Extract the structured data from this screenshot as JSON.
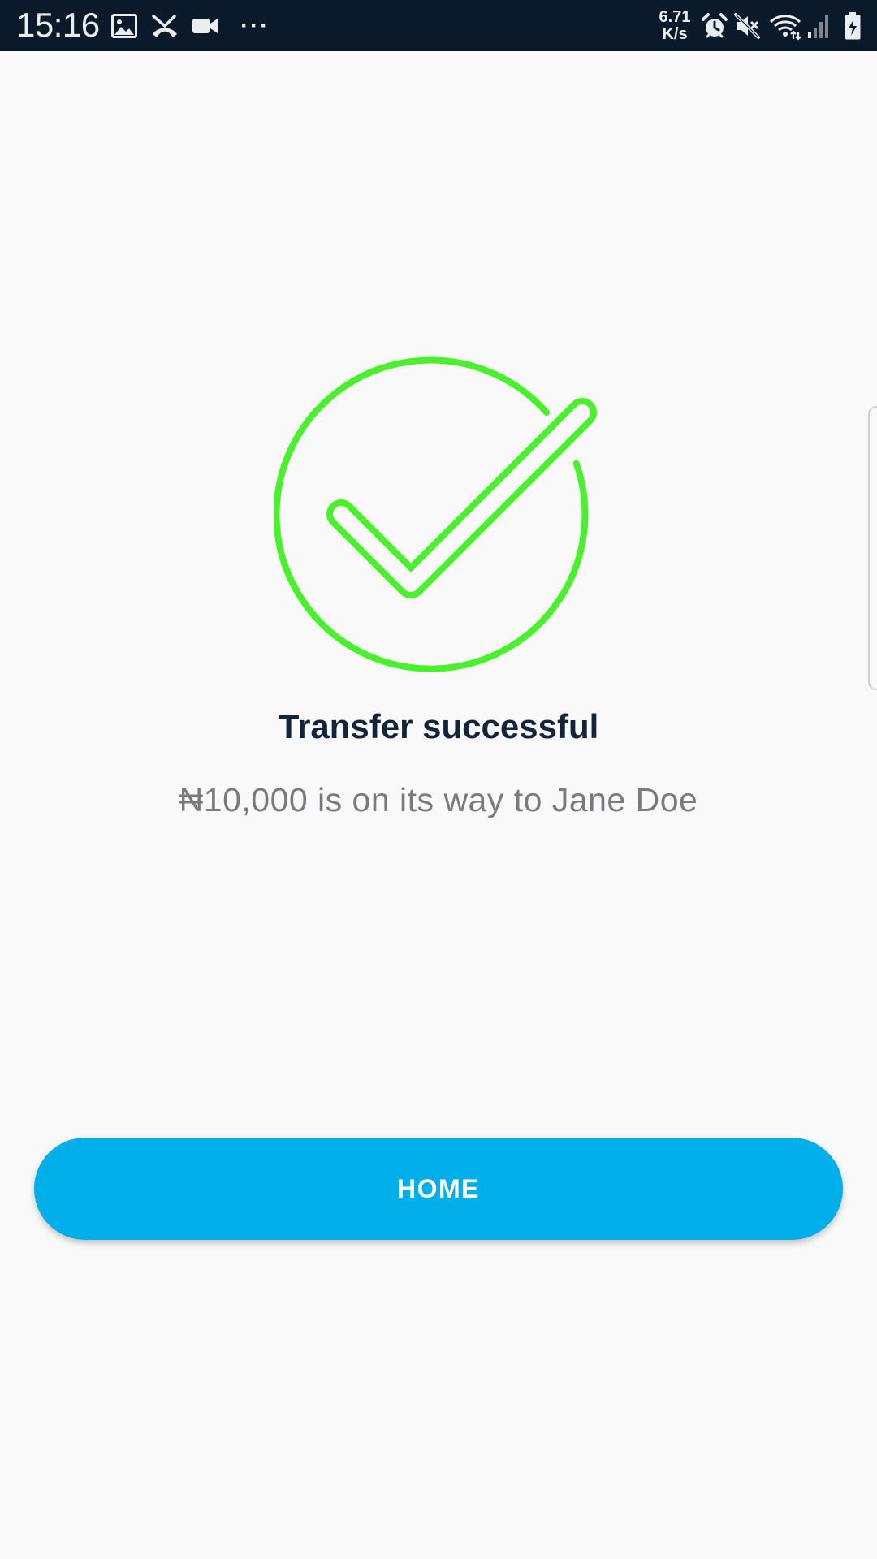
{
  "status_bar": {
    "time": "15:16",
    "more": "···",
    "net_speed_value": "6.71",
    "net_speed_unit": "K/s",
    "icons": [
      "image-icon",
      "missed-call-icon",
      "video-icon",
      "more-icon",
      "alarm-icon",
      "mute-icon",
      "wifi-icon",
      "signal-icon",
      "battery-charging-icon"
    ]
  },
  "colors": {
    "accent": "#00aeea",
    "success": "#49f02c",
    "title": "#13233a",
    "subtitle": "#7a7a7e",
    "background": "#f9f9fa",
    "status_bar": "#0b1a2a"
  },
  "main": {
    "icon": "success-check-icon",
    "title": "Transfer successful",
    "message": "₦10,000 is on its way to Jane Doe"
  },
  "actions": {
    "home_label": "HOME"
  }
}
